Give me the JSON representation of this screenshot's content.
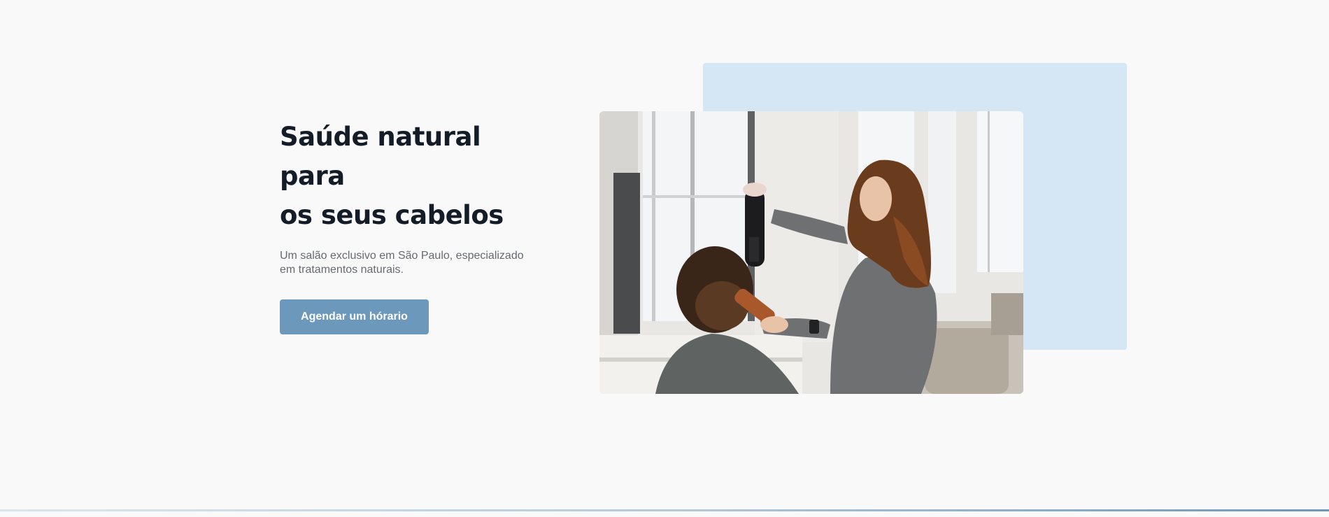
{
  "hero": {
    "title_line1": "Saúde natural para",
    "title_line2": "os seus cabelos",
    "subtitle": "Um salão exclusivo em São Paulo, especializado em tratamentos naturais.",
    "cta_label": "Agendar um hórario"
  },
  "colors": {
    "background": "#f9f9f9",
    "title": "#131c27",
    "subtitle": "#666a70",
    "accent": "#6c98bb",
    "backdrop": "#d5e7f5"
  },
  "image": {
    "subject": "salon-hairdresser-photo"
  }
}
